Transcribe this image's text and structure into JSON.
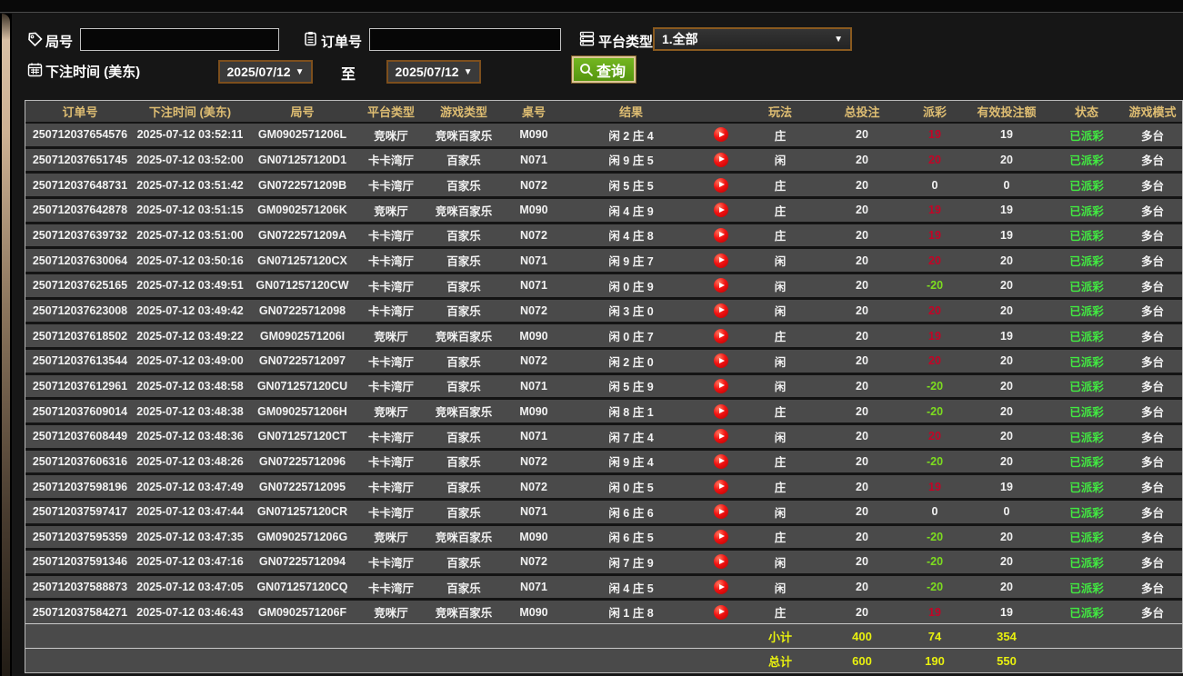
{
  "filters": {
    "round_label": "局号",
    "round_value": "",
    "order_label": "订单号",
    "order_value": "",
    "platform_label": "平台类型",
    "platform_value": "1.全部",
    "bet_time_label": "下注时间 (美东)",
    "date_from": "2025/07/12",
    "to_label": "至",
    "date_to": "2025/07/12",
    "query_label": "查询"
  },
  "table": {
    "columns": [
      "订单号",
      "下注时间 (美东)",
      "局号",
      "平台类型",
      "游戏类型",
      "桌号",
      "结果",
      "",
      "玩法",
      "总投注",
      "派彩",
      "有效投注额",
      "状态",
      "游戏模式"
    ],
    "rows": [
      {
        "order": "250712037654576",
        "time": "2025-07-12 03:52:11",
        "round": "GM0902571206L",
        "platform": "竞咪厅",
        "game_type": "竞咪百家乐",
        "table_no": "M090",
        "result": "闲 2 庄 4",
        "play": "庄",
        "total_bet": "20",
        "payout": "19",
        "payout_color": "red",
        "valid_bet": "19",
        "status": "已派彩",
        "mode": "多台"
      },
      {
        "order": "250712037651745",
        "time": "2025-07-12 03:52:00",
        "round": "GN071257120D1",
        "platform": "卡卡湾厅",
        "game_type": "百家乐",
        "table_no": "N071",
        "result": "闲 9 庄 5",
        "play": "闲",
        "total_bet": "20",
        "payout": "20",
        "payout_color": "red",
        "valid_bet": "20",
        "status": "已派彩",
        "mode": "多台"
      },
      {
        "order": "250712037648731",
        "time": "2025-07-12 03:51:42",
        "round": "GN0722571209B",
        "platform": "卡卡湾厅",
        "game_type": "百家乐",
        "table_no": "N072",
        "result": "闲 5 庄 5",
        "play": "庄",
        "total_bet": "20",
        "payout": "0",
        "payout_color": "white",
        "valid_bet": "0",
        "status": "已派彩",
        "mode": "多台"
      },
      {
        "order": "250712037642878",
        "time": "2025-07-12 03:51:15",
        "round": "GM0902571206K",
        "platform": "竞咪厅",
        "game_type": "竞咪百家乐",
        "table_no": "M090",
        "result": "闲 4 庄 9",
        "play": "庄",
        "total_bet": "20",
        "payout": "19",
        "payout_color": "red",
        "valid_bet": "19",
        "status": "已派彩",
        "mode": "多台"
      },
      {
        "order": "250712037639732",
        "time": "2025-07-12 03:51:00",
        "round": "GN0722571209A",
        "platform": "卡卡湾厅",
        "game_type": "百家乐",
        "table_no": "N072",
        "result": "闲 4 庄 8",
        "play": "庄",
        "total_bet": "20",
        "payout": "19",
        "payout_color": "red",
        "valid_bet": "19",
        "status": "已派彩",
        "mode": "多台"
      },
      {
        "order": "250712037630064",
        "time": "2025-07-12 03:50:16",
        "round": "GN071257120CX",
        "platform": "卡卡湾厅",
        "game_type": "百家乐",
        "table_no": "N071",
        "result": "闲 9 庄 7",
        "play": "闲",
        "total_bet": "20",
        "payout": "20",
        "payout_color": "red",
        "valid_bet": "20",
        "status": "已派彩",
        "mode": "多台"
      },
      {
        "order": "250712037625165",
        "time": "2025-07-12 03:49:51",
        "round": "GN071257120CW",
        "platform": "卡卡湾厅",
        "game_type": "百家乐",
        "table_no": "N071",
        "result": "闲 0 庄 9",
        "play": "闲",
        "total_bet": "20",
        "payout": "-20",
        "payout_color": "green",
        "valid_bet": "20",
        "status": "已派彩",
        "mode": "多台"
      },
      {
        "order": "250712037623008",
        "time": "2025-07-12 03:49:42",
        "round": "GN07225712098",
        "platform": "卡卡湾厅",
        "game_type": "百家乐",
        "table_no": "N072",
        "result": "闲 3 庄 0",
        "play": "闲",
        "total_bet": "20",
        "payout": "20",
        "payout_color": "red",
        "valid_bet": "20",
        "status": "已派彩",
        "mode": "多台"
      },
      {
        "order": "250712037618502",
        "time": "2025-07-12 03:49:22",
        "round": "GM0902571206I",
        "platform": "竞咪厅",
        "game_type": "竞咪百家乐",
        "table_no": "M090",
        "result": "闲 0 庄 7",
        "play": "庄",
        "total_bet": "20",
        "payout": "19",
        "payout_color": "red",
        "valid_bet": "19",
        "status": "已派彩",
        "mode": "多台"
      },
      {
        "order": "250712037613544",
        "time": "2025-07-12 03:49:00",
        "round": "GN07225712097",
        "platform": "卡卡湾厅",
        "game_type": "百家乐",
        "table_no": "N072",
        "result": "闲 2 庄 0",
        "play": "闲",
        "total_bet": "20",
        "payout": "20",
        "payout_color": "red",
        "valid_bet": "20",
        "status": "已派彩",
        "mode": "多台"
      },
      {
        "order": "250712037612961",
        "time": "2025-07-12 03:48:58",
        "round": "GN071257120CU",
        "platform": "卡卡湾厅",
        "game_type": "百家乐",
        "table_no": "N071",
        "result": "闲 5 庄 9",
        "play": "闲",
        "total_bet": "20",
        "payout": "-20",
        "payout_color": "green",
        "valid_bet": "20",
        "status": "已派彩",
        "mode": "多台"
      },
      {
        "order": "250712037609014",
        "time": "2025-07-12 03:48:38",
        "round": "GM0902571206H",
        "platform": "竞咪厅",
        "game_type": "竞咪百家乐",
        "table_no": "M090",
        "result": "闲 8 庄 1",
        "play": "庄",
        "total_bet": "20",
        "payout": "-20",
        "payout_color": "green",
        "valid_bet": "20",
        "status": "已派彩",
        "mode": "多台"
      },
      {
        "order": "250712037608449",
        "time": "2025-07-12 03:48:36",
        "round": "GN071257120CT",
        "platform": "卡卡湾厅",
        "game_type": "百家乐",
        "table_no": "N071",
        "result": "闲 7 庄 4",
        "play": "闲",
        "total_bet": "20",
        "payout": "20",
        "payout_color": "red",
        "valid_bet": "20",
        "status": "已派彩",
        "mode": "多台"
      },
      {
        "order": "250712037606316",
        "time": "2025-07-12 03:48:26",
        "round": "GN07225712096",
        "platform": "卡卡湾厅",
        "game_type": "百家乐",
        "table_no": "N072",
        "result": "闲 9 庄 4",
        "play": "庄",
        "total_bet": "20",
        "payout": "-20",
        "payout_color": "green",
        "valid_bet": "20",
        "status": "已派彩",
        "mode": "多台"
      },
      {
        "order": "250712037598196",
        "time": "2025-07-12 03:47:49",
        "round": "GN07225712095",
        "platform": "卡卡湾厅",
        "game_type": "百家乐",
        "table_no": "N072",
        "result": "闲 0 庄 5",
        "play": "庄",
        "total_bet": "20",
        "payout": "19",
        "payout_color": "red",
        "valid_bet": "19",
        "status": "已派彩",
        "mode": "多台"
      },
      {
        "order": "250712037597417",
        "time": "2025-07-12 03:47:44",
        "round": "GN071257120CR",
        "platform": "卡卡湾厅",
        "game_type": "百家乐",
        "table_no": "N071",
        "result": "闲 6 庄 6",
        "play": "闲",
        "total_bet": "20",
        "payout": "0",
        "payout_color": "white",
        "valid_bet": "0",
        "status": "已派彩",
        "mode": "多台"
      },
      {
        "order": "250712037595359",
        "time": "2025-07-12 03:47:35",
        "round": "GM0902571206G",
        "platform": "竞咪厅",
        "game_type": "竞咪百家乐",
        "table_no": "M090",
        "result": "闲 6 庄 5",
        "play": "庄",
        "total_bet": "20",
        "payout": "-20",
        "payout_color": "green",
        "valid_bet": "20",
        "status": "已派彩",
        "mode": "多台"
      },
      {
        "order": "250712037591346",
        "time": "2025-07-12 03:47:16",
        "round": "GN07225712094",
        "platform": "卡卡湾厅",
        "game_type": "百家乐",
        "table_no": "N072",
        "result": "闲 7 庄 9",
        "play": "闲",
        "total_bet": "20",
        "payout": "-20",
        "payout_color": "green",
        "valid_bet": "20",
        "status": "已派彩",
        "mode": "多台"
      },
      {
        "order": "250712037588873",
        "time": "2025-07-12 03:47:05",
        "round": "GN071257120CQ",
        "platform": "卡卡湾厅",
        "game_type": "百家乐",
        "table_no": "N071",
        "result": "闲 4 庄 5",
        "play": "闲",
        "total_bet": "20",
        "payout": "-20",
        "payout_color": "green",
        "valid_bet": "20",
        "status": "已派彩",
        "mode": "多台"
      },
      {
        "order": "250712037584271",
        "time": "2025-07-12 03:46:43",
        "round": "GM0902571206F",
        "platform": "竞咪厅",
        "game_type": "竞咪百家乐",
        "table_no": "M090",
        "result": "闲 1 庄 8",
        "play": "庄",
        "total_bet": "20",
        "payout": "19",
        "payout_color": "red",
        "valid_bet": "19",
        "status": "已派彩",
        "mode": "多台"
      }
    ],
    "subtotal": {
      "label": "小计",
      "total_bet": "400",
      "payout": "74",
      "valid_bet": "354"
    },
    "total": {
      "label": "总计",
      "total_bet": "600",
      "payout": "190",
      "valid_bet": "550"
    }
  },
  "colors": {
    "page_bg": "#161616",
    "table_bg": "#141414",
    "table_border": "#b9b9b9",
    "header_bg": "#3d3d3d",
    "row_bg": "#4a4a4a",
    "gold": "#debd72",
    "text": "#f2f2f2",
    "payout_win_red": "#c30426",
    "payout_loss_green": "#7ddd1f",
    "status_green": "#41e941",
    "totals_yellow": "#e8f00f",
    "accent_border_orange": "#8a5a1f",
    "query_green": "#5ea012",
    "play_red": "#e00404"
  }
}
